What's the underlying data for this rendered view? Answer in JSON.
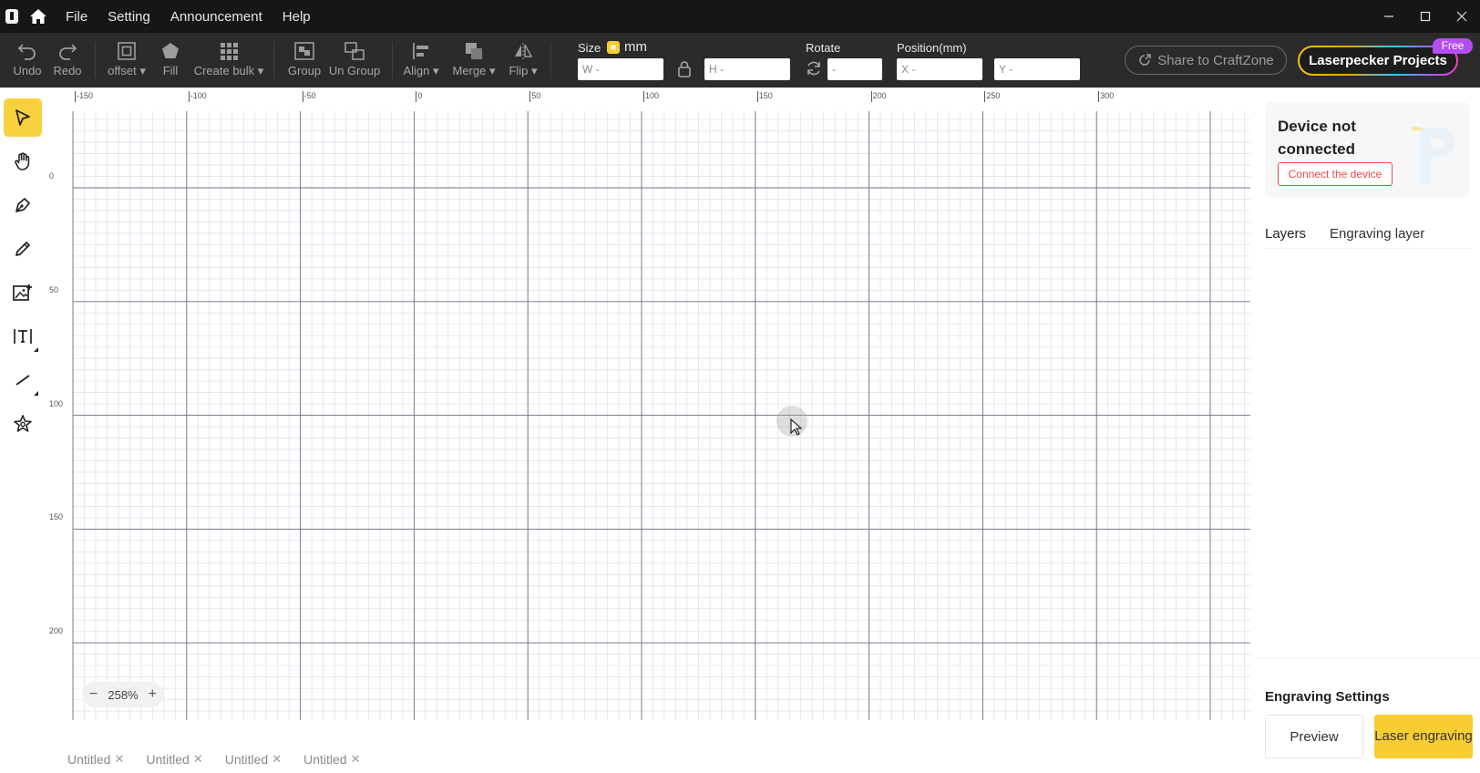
{
  "titlebar": {
    "menus": [
      "File",
      "Setting",
      "Announcement",
      "Help"
    ]
  },
  "toolbar": {
    "undo": "Undo",
    "redo": "Redo",
    "offset": "offset",
    "fill": "Fill",
    "create_bulk": "Create bulk",
    "group": "Group",
    "ungroup": "Un Group",
    "align": "Align",
    "merge": "Merge",
    "flip": "Flip",
    "size_label": "Size",
    "unit": "mm",
    "w_placeholder": "W -",
    "h_placeholder": "H -",
    "rotate_label": "Rotate",
    "rotate_placeholder": "-",
    "position_label": "Position(mm)",
    "x_placeholder": "X -",
    "y_placeholder": "Y -",
    "share": "Share to CraftZone",
    "projects": "Laserpecker Projects",
    "free_badge": "Free"
  },
  "canvas": {
    "ruler_h_labels": [
      "-150",
      "-100",
      "-50",
      "0",
      "50",
      "100",
      "150",
      "200",
      "250",
      "300"
    ],
    "ruler_v_labels": [
      "0",
      "50",
      "100",
      "150",
      "200"
    ],
    "zoom": "258%"
  },
  "tabs": [
    "Untitled",
    "Untitled",
    "Untitled",
    "Untitled"
  ],
  "rightpanel": {
    "device_title": "Device not connected",
    "connect_button": "Connect the device",
    "tab_layers": "Layers",
    "tab_engraving_layer": "Engraving layer",
    "engraving_settings": "Engraving Settings",
    "preview": "Preview",
    "laser_engraving": "Laser engraving"
  },
  "colors": {
    "accent": "#f7cd32",
    "connect_red": "#e84b4b",
    "badge_purple": "#b44ef0"
  }
}
